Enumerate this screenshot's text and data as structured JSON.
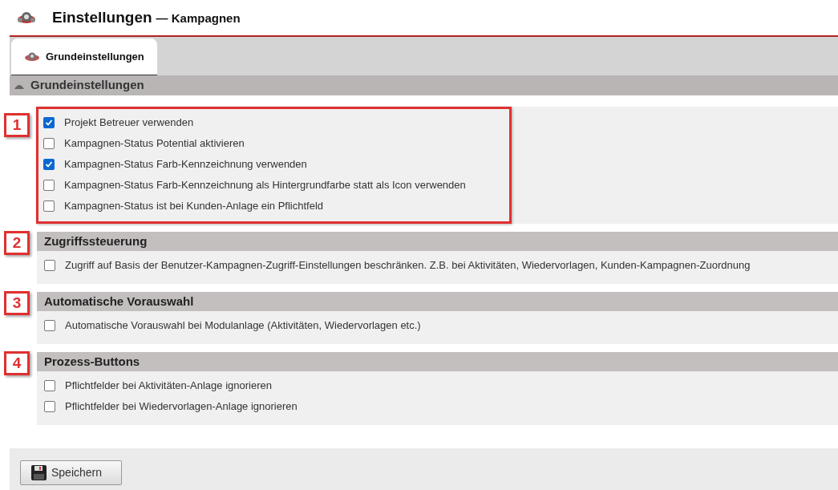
{
  "window": {
    "title": "Einstellungen",
    "subtitle": "— Kampagnen"
  },
  "tabs": [
    {
      "label": "Grundeinstellungen",
      "selected": true
    }
  ],
  "panel_header": "Grundeinstellungen",
  "sections": [
    {
      "callout": "1",
      "highlighted": true,
      "options": [
        {
          "label": "Projekt Betreuer verwenden",
          "checked": true
        },
        {
          "label": "Kampagnen-Status Potential aktivieren",
          "checked": false
        },
        {
          "label": "Kampagnen-Status Farb-Kennzeichnung verwenden",
          "checked": true
        },
        {
          "label": "Kampagnen-Status Farb-Kennzeichnung als Hintergrundfarbe statt als Icon verwenden",
          "checked": false
        },
        {
          "label": "Kampagnen-Status ist bei Kunden-Anlage ein Pflichtfeld",
          "checked": false
        }
      ]
    },
    {
      "callout": "2",
      "title": "Zugriffssteuerung",
      "highlighted": false,
      "options": [
        {
          "label": "Zugriff auf Basis der Benutzer-Kampagnen-Zugriff-Einstellungen beschränken. Z.B. bei Aktivitäten, Wiedervorlagen, Kunden-Kampagnen-Zuordnung",
          "checked": false
        }
      ]
    },
    {
      "callout": "3",
      "title": "Automatische Vorauswahl",
      "highlighted": false,
      "options": [
        {
          "label": "Automatische Vorauswahl bei Modulanlage (Aktivitäten, Wiedervorlagen etc.)",
          "checked": false
        }
      ]
    },
    {
      "callout": "4",
      "title": "Prozess-Buttons",
      "highlighted": false,
      "options": [
        {
          "label": "Pflichtfelder bei Aktivitäten-Anlage ignorieren",
          "checked": false
        },
        {
          "label": "Pflichtfelder bei Wiedervorlagen-Anlage ignorieren",
          "checked": false
        }
      ]
    }
  ],
  "save_button": "Speichern"
}
